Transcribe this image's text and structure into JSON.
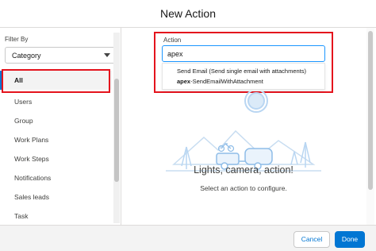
{
  "header": {
    "title": "New Action"
  },
  "sidebar": {
    "filter_label": "Filter By",
    "filter_value": "Category",
    "items": [
      {
        "label": "All"
      },
      {
        "label": "Users"
      },
      {
        "label": "Group"
      },
      {
        "label": "Work Plans"
      },
      {
        "label": "Work Steps"
      },
      {
        "label": "Notifications"
      },
      {
        "label": "Sales leads"
      },
      {
        "label": "Task"
      }
    ]
  },
  "main": {
    "action_label": "Action",
    "search_value": "apex",
    "dropdown": {
      "line1": "Send Email (Send single email with attachments)",
      "line2_bold": "apex",
      "line2_rest": "-SendEmailWithAttachment"
    },
    "empty_title": "Lights, camera, action!",
    "empty_subtitle": "Select an action to configure."
  },
  "footer": {
    "cancel_label": "Cancel",
    "done_label": "Done"
  },
  "colors": {
    "brand": "#0176d3",
    "highlight": "#e4131d",
    "illustration": "#b9d6f2"
  }
}
